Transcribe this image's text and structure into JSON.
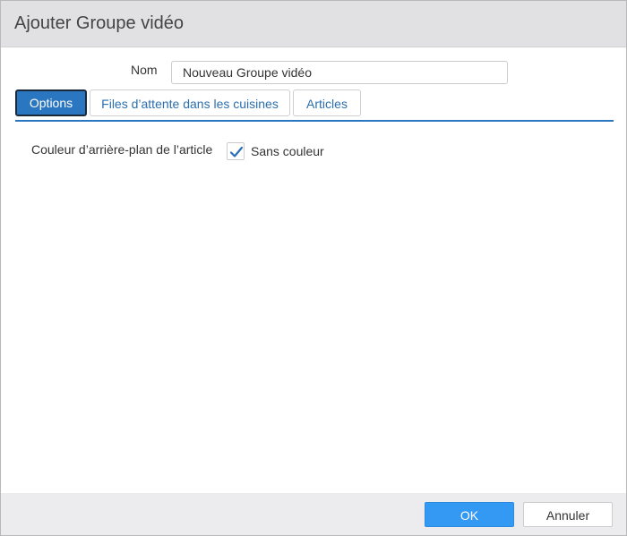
{
  "dialog": {
    "title": "Ajouter Groupe vidéo"
  },
  "name_field": {
    "label": "Nom",
    "value": "Nouveau Groupe vidéo"
  },
  "tabs": [
    {
      "label": "Options",
      "active": true
    },
    {
      "label": "Files d’attente dans les cuisines",
      "active": false
    },
    {
      "label": "Articles",
      "active": false
    }
  ],
  "options": {
    "background_label": "Couleur d’arrière-plan de l’article",
    "no_color_label": "Sans couleur",
    "no_color_checked": true
  },
  "footer": {
    "ok_label": "OK",
    "cancel_label": "Annuler"
  },
  "colors": {
    "accent": "#2a76c0",
    "ok_button": "#3399f3",
    "titlebar": "#e1e1e3"
  },
  "icons": {
    "checkbox": "checkmark-icon"
  }
}
